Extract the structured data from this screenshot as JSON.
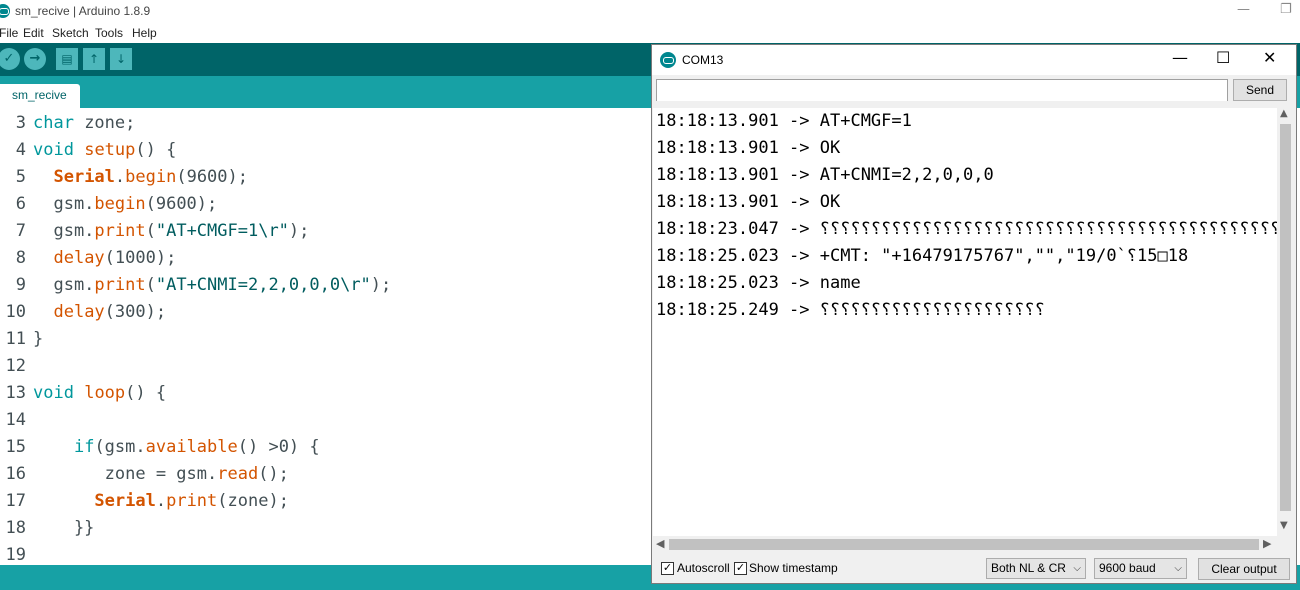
{
  "ide": {
    "window_title": "sm_recive | Arduino 1.8.9",
    "menu": [
      "File",
      "Edit",
      "Sketch",
      "Tools",
      "Help"
    ],
    "tab": "sm_recive",
    "toolbar": {
      "verify": "✓",
      "upload": "→",
      "new": "▤",
      "open": "↑",
      "save": "↓"
    },
    "window_controls": {
      "minimize": "—",
      "restore": "❐"
    }
  },
  "code_lines": [
    {
      "num": "3",
      "code": "char zone;"
    },
    {
      "num": "4",
      "code": "void setup() {"
    },
    {
      "num": "5",
      "code": "  Serial.begin(9600);"
    },
    {
      "num": "6",
      "code": "  gsm.begin(9600);"
    },
    {
      "num": "7",
      "code": "  gsm.print(\"AT+CMGF=1\\r\");"
    },
    {
      "num": "8",
      "code": "  delay(1000);"
    },
    {
      "num": "9",
      "code": "  gsm.print(\"AT+CNMI=2,2,0,0,0\\r\");"
    },
    {
      "num": "10",
      "code": "  delay(300);"
    },
    {
      "num": "11",
      "code": "}"
    },
    {
      "num": "12",
      "code": ""
    },
    {
      "num": "13",
      "code": "void loop() {"
    },
    {
      "num": "14",
      "code": ""
    },
    {
      "num": "15",
      "code": "    if(gsm.available() >0) {"
    },
    {
      "num": "16",
      "code": "       zone = gsm.read();"
    },
    {
      "num": "17",
      "code": "      Serial.print(zone);"
    },
    {
      "num": "18",
      "code": "    }}"
    },
    {
      "num": "19",
      "code": ""
    }
  ],
  "serial": {
    "title": "COM13",
    "input_value": "",
    "send_label": "Send",
    "output": [
      "18:18:13.901 -> AT+CMGF=1",
      "18:18:13.901 -> OK",
      "18:18:13.901 -> AT+CNMI=2,2,0,0,0",
      "18:18:13.901 -> OK",
      "18:18:23.047 -> ⸮⸮⸮⸮⸮⸮⸮⸮⸮⸮⸮⸮⸮⸮⸮⸮⸮⸮⸮⸮⸮⸮⸮⸮⸮⸮⸮⸮⸮⸮⸮⸮⸮⸮⸮⸮⸮⸮⸮⸮⸮⸮⸮⸮⸮⸮⸮⸮⸮⸮",
      "18:18:25.023 -> +CMT: \"+16479175767\",\"\",\"19/0`⸮15□18",
      "18:18:25.023 -> name",
      "18:18:25.249 -> ⸮⸮⸮⸮⸮⸮⸮⸮⸮⸮⸮⸮⸮⸮⸮⸮⸮⸮⸮⸮⸮⸮"
    ],
    "autoscroll_label": "Autoscroll",
    "autoscroll_checked": true,
    "timestamp_label": "Show timestamp",
    "timestamp_checked": true,
    "line_ending": "Both NL & CR",
    "baud": "9600 baud",
    "clear_label": "Clear output",
    "controls": {
      "minimize": "—",
      "maximize": "☐",
      "close": "✕"
    }
  }
}
